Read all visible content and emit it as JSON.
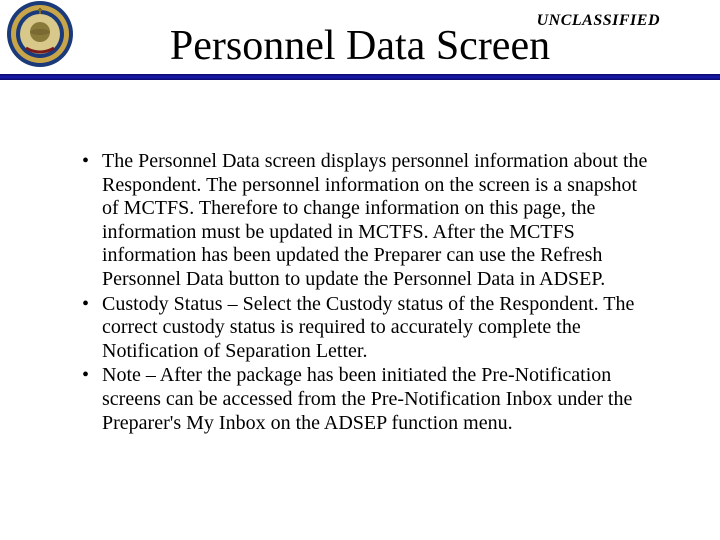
{
  "header": {
    "classification": "UNCLASSIFIED",
    "title": "Personnel Data Screen",
    "seal_alt": "marine-corps-seal"
  },
  "bullets": [
    "The Personnel Data screen displays personnel information about the Respondent.  The personnel information on the screen is a snapshot of MCTFS.  Therefore to change information on this page, the information must be updated in MCTFS.  After the MCTFS information has been updated the Preparer can use the Refresh Personnel Data button to update the Personnel Data in ADSEP.",
    "Custody Status – Select the Custody status of the Respondent.  The correct custody status is required to accurately complete the Notification of Separation Letter.",
    "Note – After the package has been initiated the Pre-Notification screens can be accessed from the Pre-Notification Inbox under the Preparer's My Inbox on the ADSEP function menu."
  ],
  "colors": {
    "divider": "#1a1ab0",
    "seal_outer": "#1b3a7a",
    "seal_gold": "#c9a54a",
    "seal_center": "#d8c98a"
  }
}
